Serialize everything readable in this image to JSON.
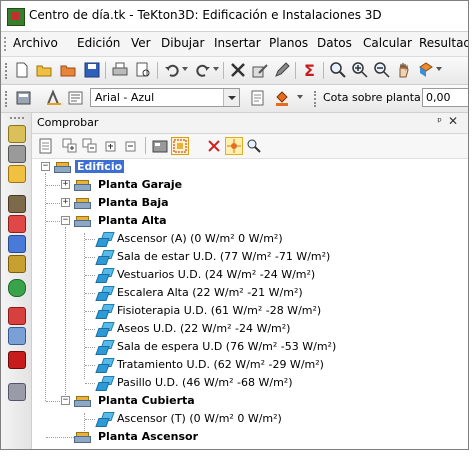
{
  "window": {
    "title": "Centro de día.tk - TeKton3D: Edificación e Instalaciones 3D"
  },
  "menu": {
    "items": [
      "Archivo",
      "Edición",
      "Ver",
      "Dibujar",
      "Insertar",
      "Planos",
      "Datos",
      "Calcular",
      "Resultado"
    ]
  },
  "toolbar": {
    "style_combo_value": "Arial - Azul",
    "cota_label": "Cota sobre planta:",
    "cota_value": "0,00"
  },
  "panel": {
    "title": "Comprobar",
    "pin": "ᵖ",
    "close": "✕"
  },
  "tree": {
    "root": "Edificio",
    "floors": [
      {
        "label": "Planta Garaje",
        "expanded": false
      },
      {
        "label": "Planta Baja",
        "expanded": false
      },
      {
        "label": "Planta Alta",
        "expanded": true,
        "rooms": [
          {
            "name": "Ascensor (A)",
            "values": "(0 W/m² 0 W/m²)"
          },
          {
            "name": "Sala de estar U.D.",
            "values": "(77 W/m² -71 W/m²)"
          },
          {
            "name": "Vestuarios U.D.",
            "values": "(24 W/m² -24 W/m²)"
          },
          {
            "name": "Escalera Alta",
            "values": "(22 W/m² -21 W/m²)"
          },
          {
            "name": "Fisioterapia U.D.",
            "values": "(61 W/m² -28 W/m²)"
          },
          {
            "name": "Aseos U.D.",
            "values": "(22 W/m² -24 W/m²)"
          },
          {
            "name": "Sala de espera U.D",
            "values": "(76 W/m² -53 W/m²)"
          },
          {
            "name": "Tratamiento U.D.",
            "values": "(62 W/m² -29 W/m²)"
          },
          {
            "name": "Pasillo U.D.",
            "values": "(46 W/m² -68 W/m²)"
          }
        ]
      },
      {
        "label": "Planta Cubierta",
        "expanded": true,
        "rooms": [
          {
            "name": "Ascensor (T)",
            "values": "(0 W/m² 0 W/m²)"
          }
        ]
      },
      {
        "label": "Planta Ascensor",
        "expanded": null
      }
    ],
    "selected": "Edificio"
  },
  "colors": {
    "selection": "#3c6fd1",
    "room_icon": "#2c9ad6"
  }
}
